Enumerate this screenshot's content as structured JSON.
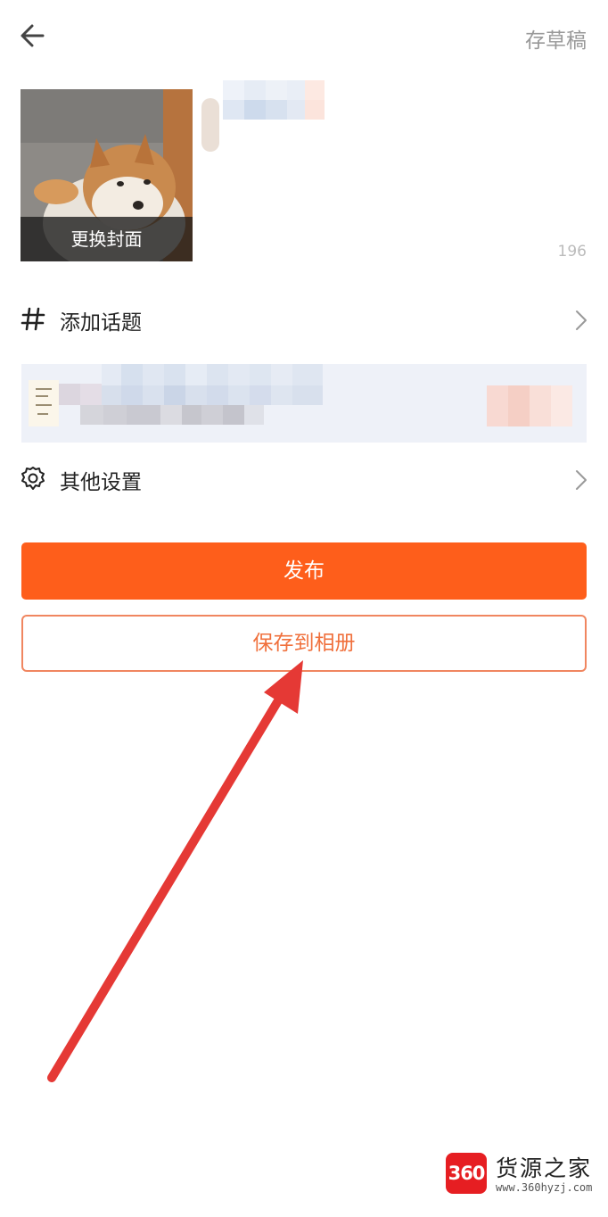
{
  "header": {
    "back_icon": "arrow-left-icon",
    "save_draft_label": "存草稿"
  },
  "cover": {
    "change_cover_label": "更换封面"
  },
  "title": {
    "char_count": "196"
  },
  "menu": {
    "topic": {
      "icon": "hashtag-icon",
      "label": "添加话题"
    },
    "settings": {
      "icon": "gear-icon",
      "label": "其他设置"
    }
  },
  "actions": {
    "publish_label": "发布",
    "save_to_album_label": "保存到相册"
  },
  "watermark": {
    "badge_text": "360",
    "name": "货源之家",
    "url": "www.360hyzj.com"
  },
  "colors": {
    "accent": "#fe5e1b",
    "outline_button": "#f08660",
    "annotation_arrow": "#e53935",
    "muted_text": "#999999"
  }
}
